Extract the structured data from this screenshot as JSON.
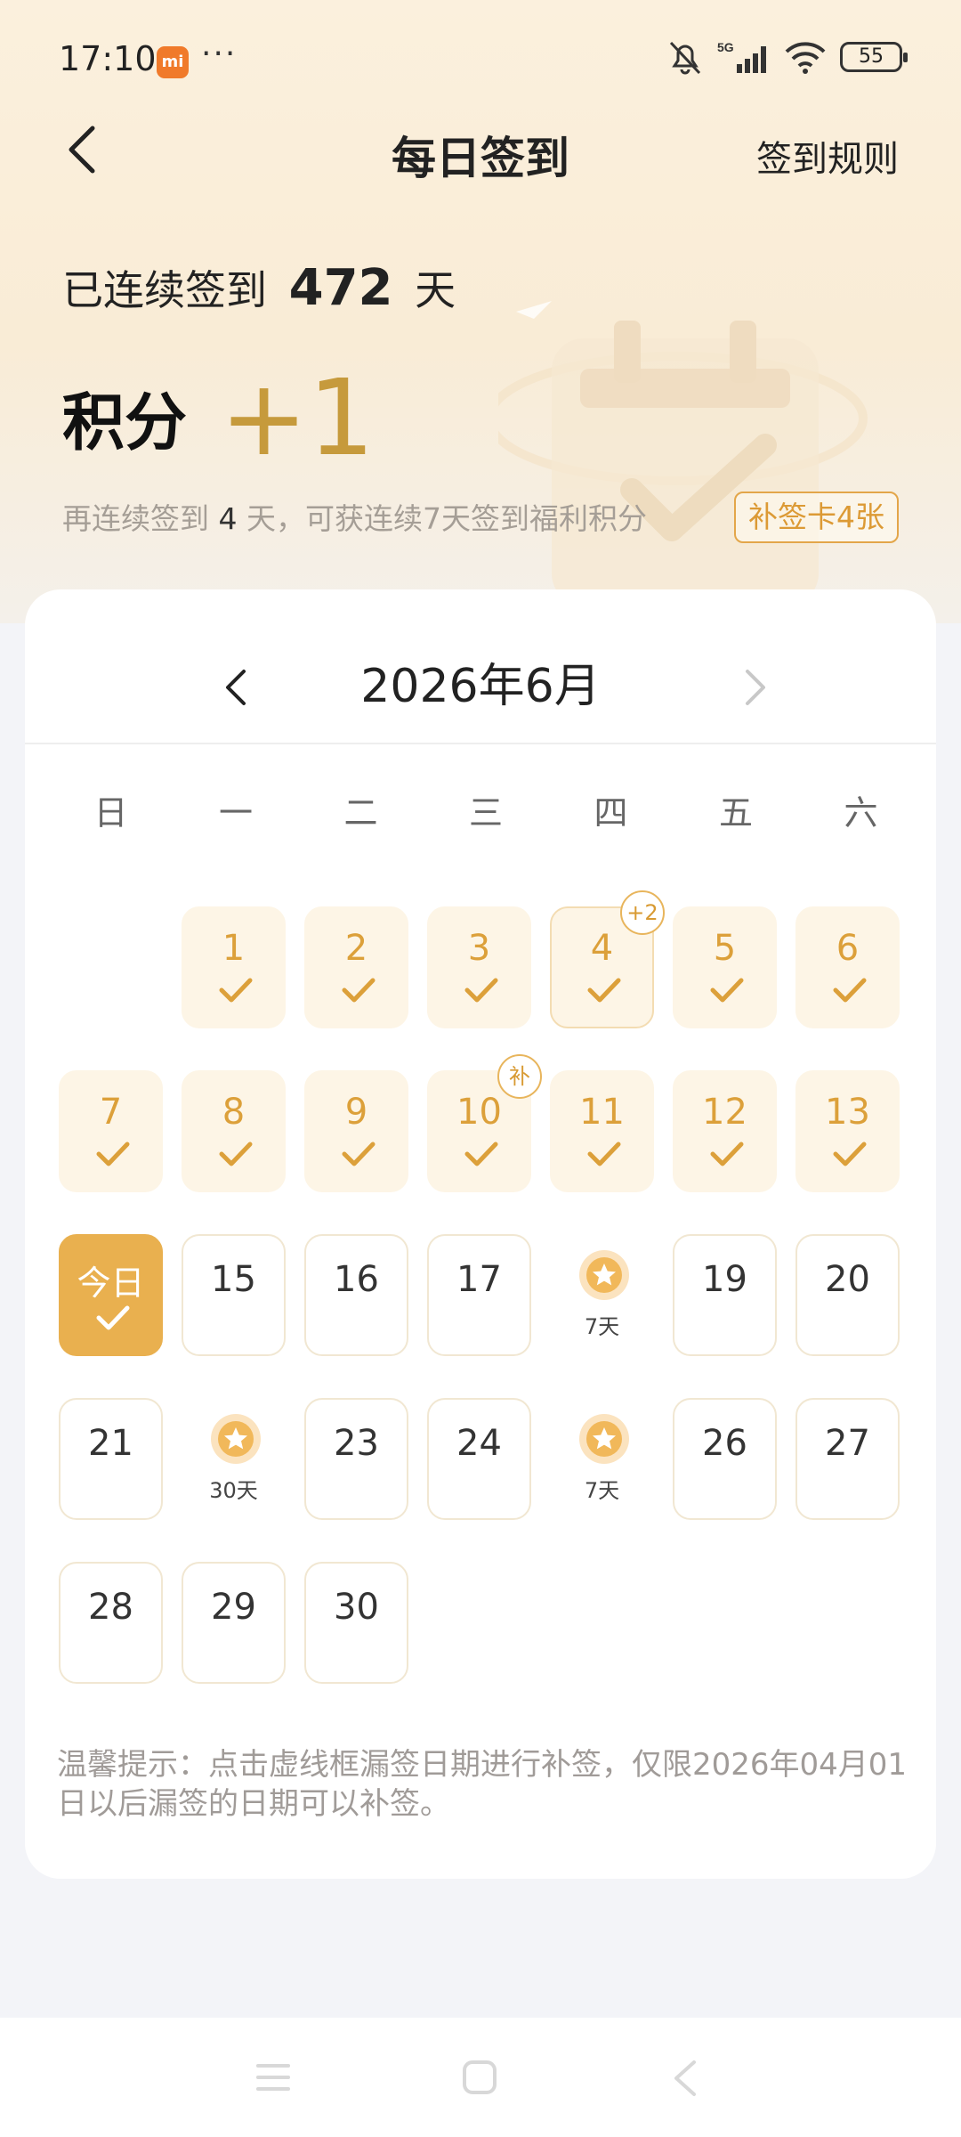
{
  "status_bar": {
    "time": "17:10",
    "signal": "5G",
    "battery": "55"
  },
  "header": {
    "title": "每日签到",
    "rules_link": "签到规则"
  },
  "summary": {
    "streak_prefix": "已连续签到",
    "streak_days": "472",
    "streak_suffix": "天",
    "points_label": "积分",
    "points_value": "+1",
    "hint_prefix": "再连续签到",
    "hint_days": "4",
    "hint_suffix": "天，可获连续7天签到福利积分",
    "makeup_cards": "补签卡4张"
  },
  "calendar": {
    "month_title": "2026年6月",
    "weekdays": [
      "日",
      "一",
      "二",
      "三",
      "四",
      "五",
      "六"
    ],
    "days": [
      {
        "label": "1",
        "state": "signed"
      },
      {
        "label": "2",
        "state": "signed"
      },
      {
        "label": "3",
        "state": "signed"
      },
      {
        "label": "4",
        "state": "signed",
        "badge": "+2"
      },
      {
        "label": "5",
        "state": "signed"
      },
      {
        "label": "6",
        "state": "signed"
      },
      {
        "label": "7",
        "state": "signed"
      },
      {
        "label": "8",
        "state": "signed"
      },
      {
        "label": "9",
        "state": "signed"
      },
      {
        "label": "10",
        "state": "signed",
        "badge": "补"
      },
      {
        "label": "11",
        "state": "signed"
      },
      {
        "label": "12",
        "state": "signed"
      },
      {
        "label": "13",
        "state": "signed"
      },
      {
        "label": "今日",
        "state": "today"
      },
      {
        "label": "15",
        "state": "future"
      },
      {
        "label": "16",
        "state": "future"
      },
      {
        "label": "17",
        "state": "future"
      },
      {
        "label": "7天",
        "state": "reward"
      },
      {
        "label": "19",
        "state": "future"
      },
      {
        "label": "20",
        "state": "future"
      },
      {
        "label": "21",
        "state": "future"
      },
      {
        "label": "30天",
        "state": "reward"
      },
      {
        "label": "23",
        "state": "future"
      },
      {
        "label": "24",
        "state": "future"
      },
      {
        "label": "7天",
        "state": "reward"
      },
      {
        "label": "26",
        "state": "future"
      },
      {
        "label": "27",
        "state": "future"
      },
      {
        "label": "28",
        "state": "future"
      },
      {
        "label": "29",
        "state": "future"
      },
      {
        "label": "30",
        "state": "future"
      }
    ],
    "first_weekday_index": 1,
    "tip": "温馨提示：点击虚线框漏签日期进行补签，仅限2026年04月01日以后漏签的日期可以补签。"
  },
  "colors": {
    "accent": "#e9b04f",
    "accent_text": "#dca03a",
    "signed_bg": "#fdf5e6"
  }
}
